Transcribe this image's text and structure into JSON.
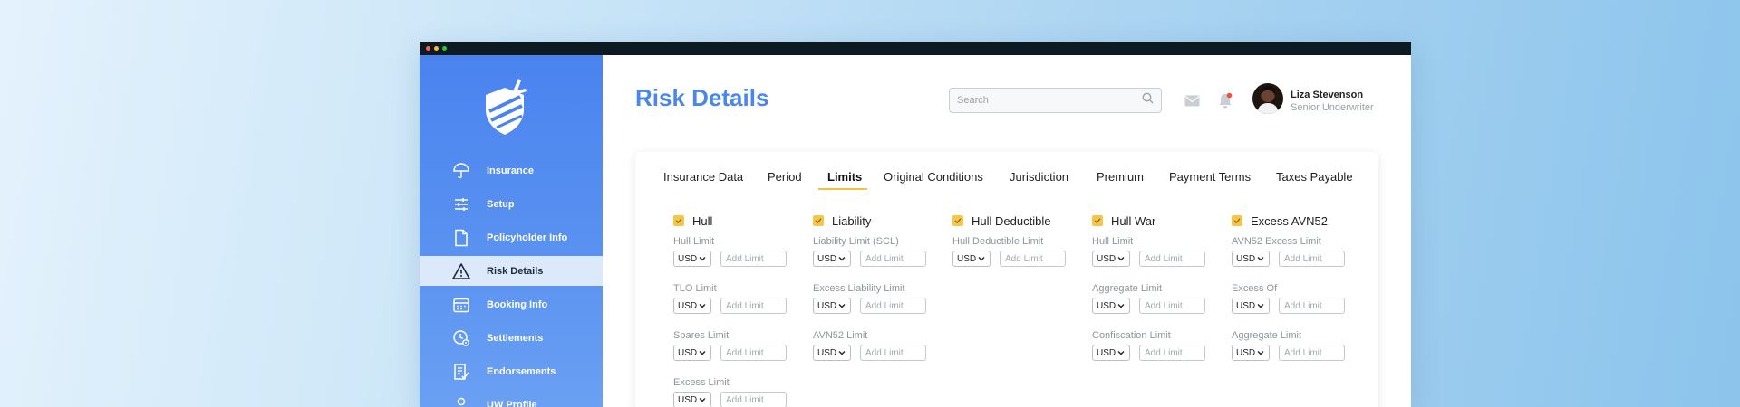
{
  "window": {
    "dots": [
      "#ff5f57",
      "#febc2e",
      "#28c840"
    ]
  },
  "sidebar": {
    "logo_icon": "shield-airplane-logo",
    "items": [
      {
        "label": "Insurance",
        "icon": "umbrella-icon",
        "active": false
      },
      {
        "label": "Setup",
        "icon": "sliders-icon",
        "active": false
      },
      {
        "label": "Policyholder Info",
        "icon": "document-icon",
        "active": false
      },
      {
        "label": "Risk Details",
        "icon": "warning-icon",
        "active": true
      },
      {
        "label": "Booking Info",
        "icon": "calendar-icon",
        "active": false
      },
      {
        "label": "Settlements",
        "icon": "settlement-icon",
        "active": false
      },
      {
        "label": "Endorsements",
        "icon": "endorsement-icon",
        "active": false
      },
      {
        "label": "UW Profile",
        "icon": "user-icon",
        "active": false
      }
    ]
  },
  "header": {
    "title": "Risk Details",
    "search": {
      "placeholder": "Search",
      "value": ""
    },
    "user": {
      "name": "Liza Stevenson",
      "role": "Senior Underwriter"
    }
  },
  "tabs": [
    {
      "label": "Insurance Data",
      "active": false
    },
    {
      "label": "Period",
      "active": false
    },
    {
      "label": "Limits",
      "active": true
    },
    {
      "label": "Original Conditions",
      "active": false
    },
    {
      "label": "Jurisdiction",
      "active": false
    },
    {
      "label": "Premium",
      "active": false
    },
    {
      "label": "Payment Terms",
      "active": false
    },
    {
      "label": "Taxes Payable",
      "active": false
    }
  ],
  "limits": {
    "currency": "USD",
    "input_placeholder": "Add Limit",
    "columns": [
      {
        "title": "Hull",
        "checked": true,
        "fields": [
          "Hull Limit",
          "TLO Limit",
          "Spares Limit",
          "Excess Limit"
        ]
      },
      {
        "title": "Liability",
        "checked": true,
        "fields": [
          "Liability Limit (SCL)",
          "Excess Liability Limit",
          "AVN52 Limit"
        ]
      },
      {
        "title": "Hull Deductible",
        "checked": true,
        "fields": [
          "Hull Deductible Limit"
        ]
      },
      {
        "title": "Hull War",
        "checked": true,
        "fields": [
          "Hull Limit",
          "Aggregate Limit",
          "Confiscation Limit"
        ]
      },
      {
        "title": "Excess AVN52",
        "checked": true,
        "fields": [
          "AVN52 Excess Limit",
          "Excess Of",
          "Aggregate Limit"
        ]
      }
    ]
  },
  "colors": {
    "sidebar_top": "#4a83ef",
    "title_blue": "#4a86ec",
    "accent_yellow": "#f2c23a",
    "active_bg": "#dbe9fb"
  }
}
